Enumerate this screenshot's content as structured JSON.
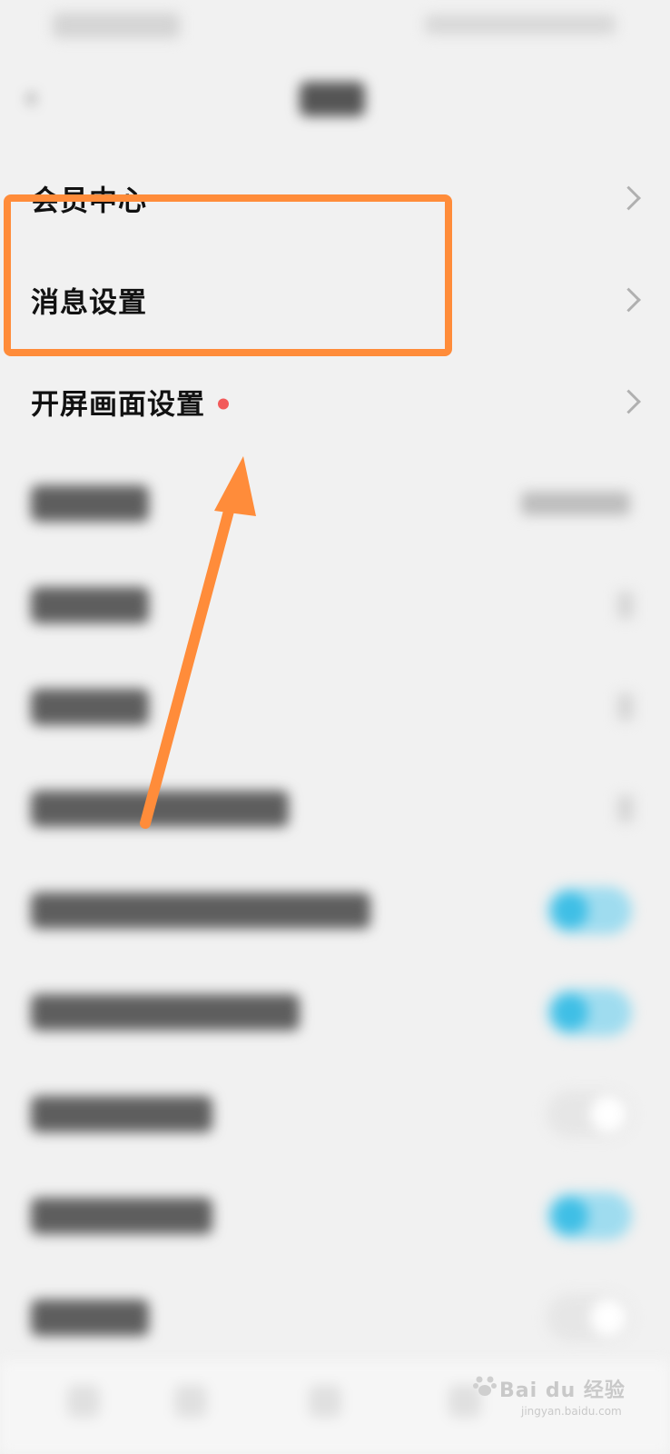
{
  "settings": {
    "items": [
      {
        "label": "会员中心"
      },
      {
        "label": "消息设置"
      },
      {
        "label": "开屏画面设置",
        "badge": "red-dot"
      }
    ]
  },
  "annotation": {
    "highlight_color": "#ff8c3a",
    "arrow_color": "#ff8c3a"
  },
  "watermark": {
    "brand": "Bai du 经验",
    "sub": "jingyan.baidu.com"
  },
  "colors": {
    "background": "#f1f1f1",
    "toggle_on": "#3fbfe6",
    "badge": "#f25a5a"
  }
}
